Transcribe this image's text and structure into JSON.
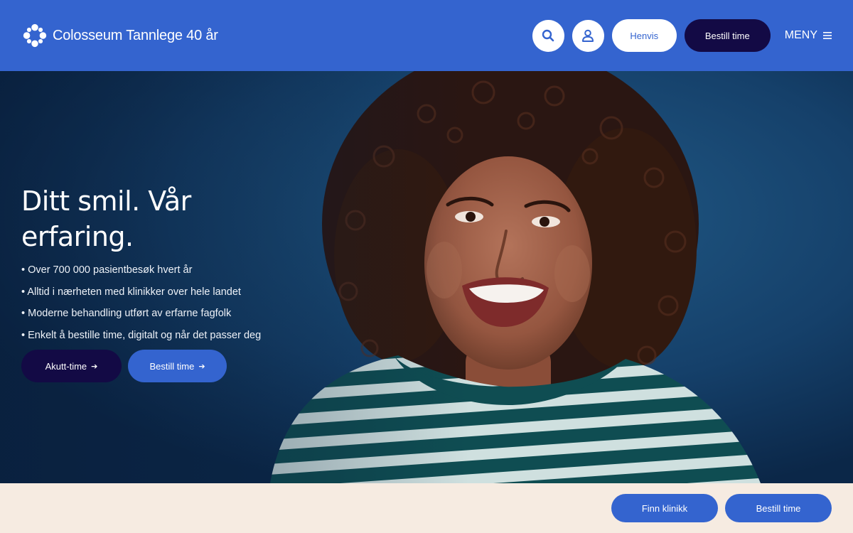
{
  "header": {
    "logo_text": "Colosseum Tannlege 40 år",
    "search_icon": "search-icon",
    "user_icon": "user-icon",
    "refer_label": "Henvis",
    "book_label": "Bestill time",
    "menu_label": "MENY"
  },
  "hero": {
    "title": "Ditt smil. Vår erfaring.",
    "bullets": [
      "Over 700 000 pasientbesøk hvert år",
      "Alltid i nærheten med klinikker over hele landet",
      "Moderne behandling utført av erfarne fagfolk",
      "Enkelt å bestille time, digitalt og når det passer deg"
    ],
    "emergency_label": "Akutt-time",
    "book_label": "Bestill time",
    "arrow": "➔"
  },
  "bottom_bar": {
    "find_clinic_label": "Finn klinikk",
    "book_label": "Bestill time"
  },
  "colors": {
    "brand_blue": "#3464cf",
    "navy": "#130a45",
    "cream": "#f6ebe1"
  }
}
